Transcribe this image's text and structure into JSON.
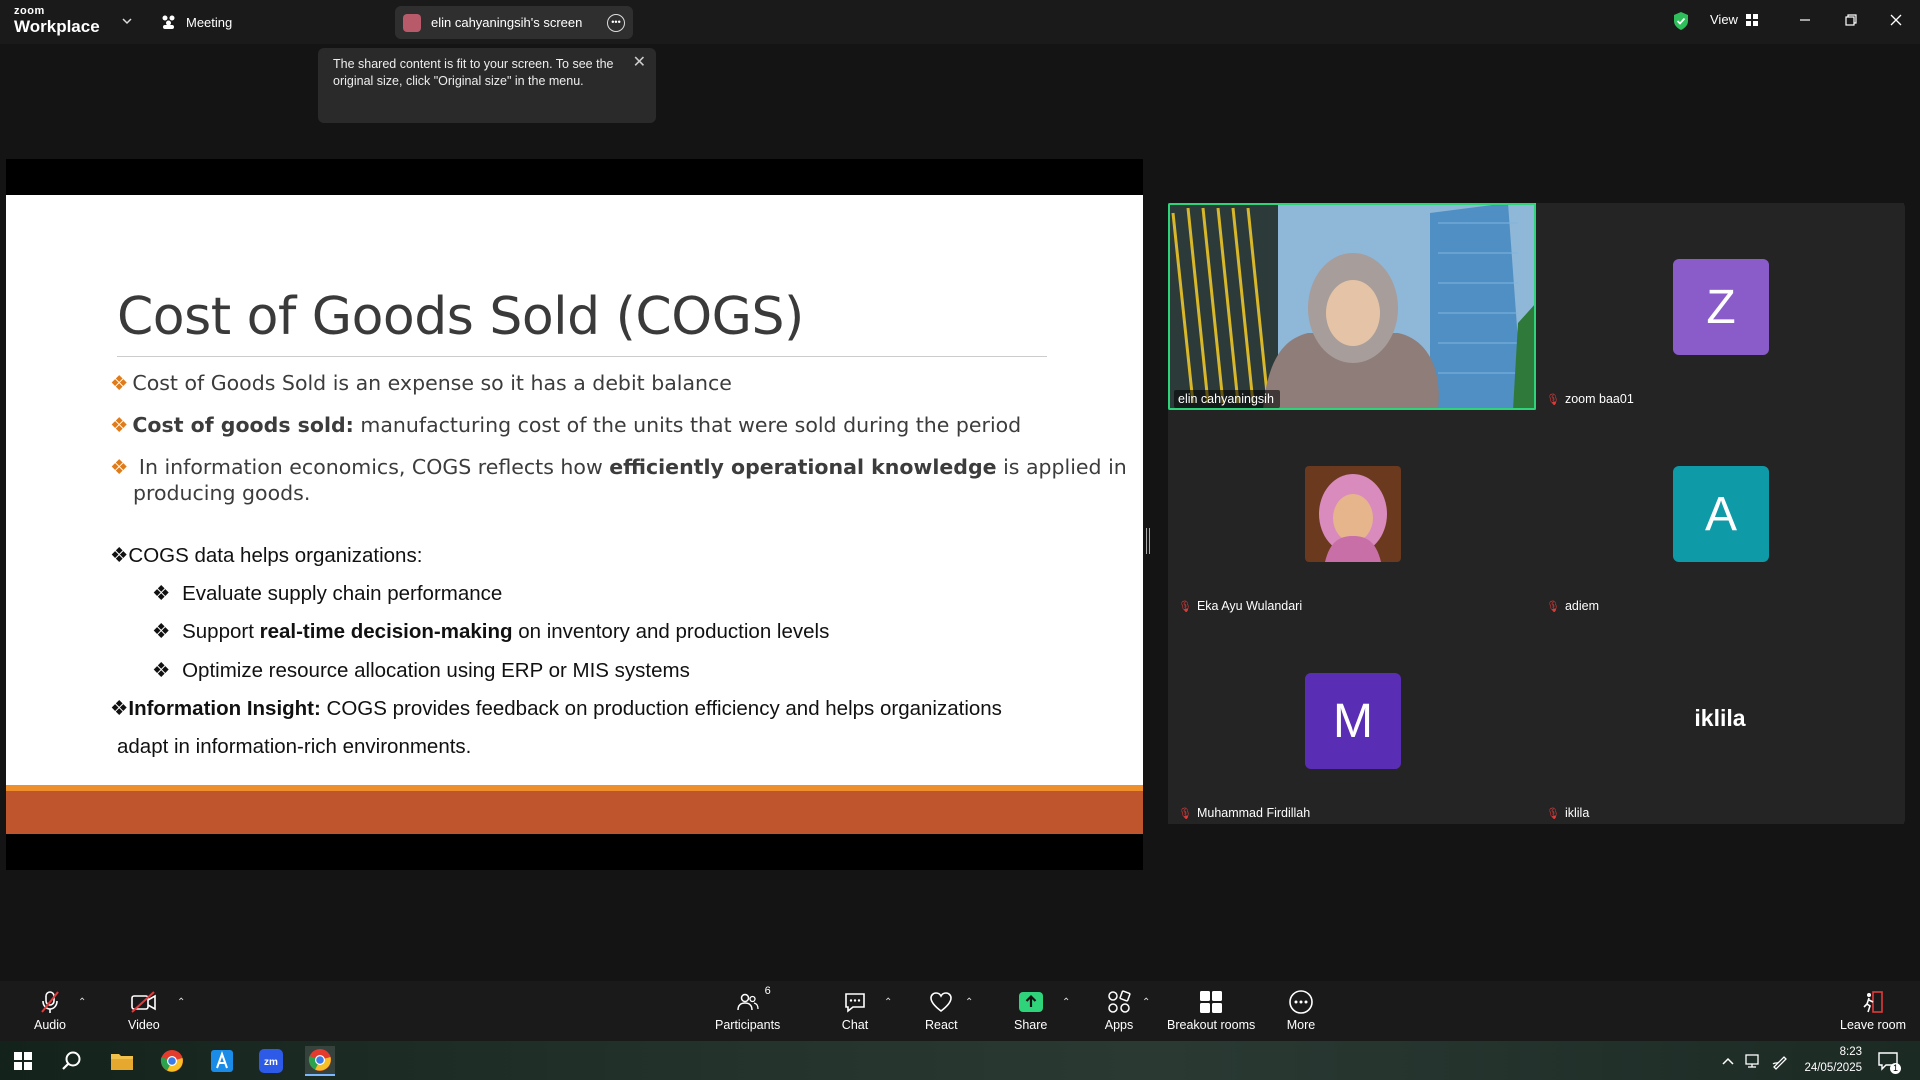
{
  "titlebar": {
    "brand_top": "zoom",
    "brand_bottom": "Workplace",
    "meeting_label": "Meeting",
    "share_label": "elin cahyaningsih's screen",
    "view_label": "View"
  },
  "tooltip": {
    "text": "The shared content is fit to your screen. To see the original size, click \"Original size\" in the menu."
  },
  "slide": {
    "title": "Cost of Goods Sold (COGS)",
    "bullet1": "Cost of Goods Sold is an expense so it has a debit balance",
    "bullet2_bold": "Cost of goods sold:",
    "bullet2_rest": " manufacturing cost of the units that were sold during the period",
    "bullet3_a": "In information economics, COGS reflects how ",
    "bullet3_bold": "efficiently operational knowledge",
    "bullet3_b": " is applied in",
    "bullet3_line2": "producing goods.",
    "bullet4": "COGS data helps organizations:",
    "sub1": "Evaluate supply chain performance",
    "sub2_a": "Support ",
    "sub2_bold": "real-time decision-making",
    "sub2_b": " on inventory and production levels",
    "sub3": "Optimize resource allocation using ERP or MIS systems",
    "bullet5_bold": "Information Insight:",
    "bullet5_rest": " COGS provides feedback on production efficiency and helps organizations",
    "bullet5_line2": "adapt in information-rich environments."
  },
  "participants": [
    {
      "name": "elin cahyaningsih",
      "type": "video"
    },
    {
      "name": "zoom baa01",
      "initial": "Z",
      "color": "#8a5cc9"
    },
    {
      "name": "Eka Ayu Wulandari",
      "type": "photo"
    },
    {
      "name": "adiem",
      "initial": "A",
      "color": "#0e9aa7"
    },
    {
      "name": "Muhammad Firdillah",
      "initial": "M",
      "color": "#5a2db5"
    },
    {
      "name": "iklila",
      "display_text": "iklila"
    }
  ],
  "toolbar": {
    "audio": "Audio",
    "video": "Video",
    "participants": "Participants",
    "participants_count": "6",
    "chat": "Chat",
    "react": "React",
    "share": "Share",
    "apps": "Apps",
    "breakout": "Breakout rooms",
    "more": "More",
    "leave": "Leave room"
  },
  "taskbar": {
    "time": "8:23",
    "date": "24/05/2025",
    "notif_count": "1"
  },
  "colors": {
    "accent_green": "#2fd47a",
    "orange": "#e07b1a",
    "band": "#bf552c"
  }
}
